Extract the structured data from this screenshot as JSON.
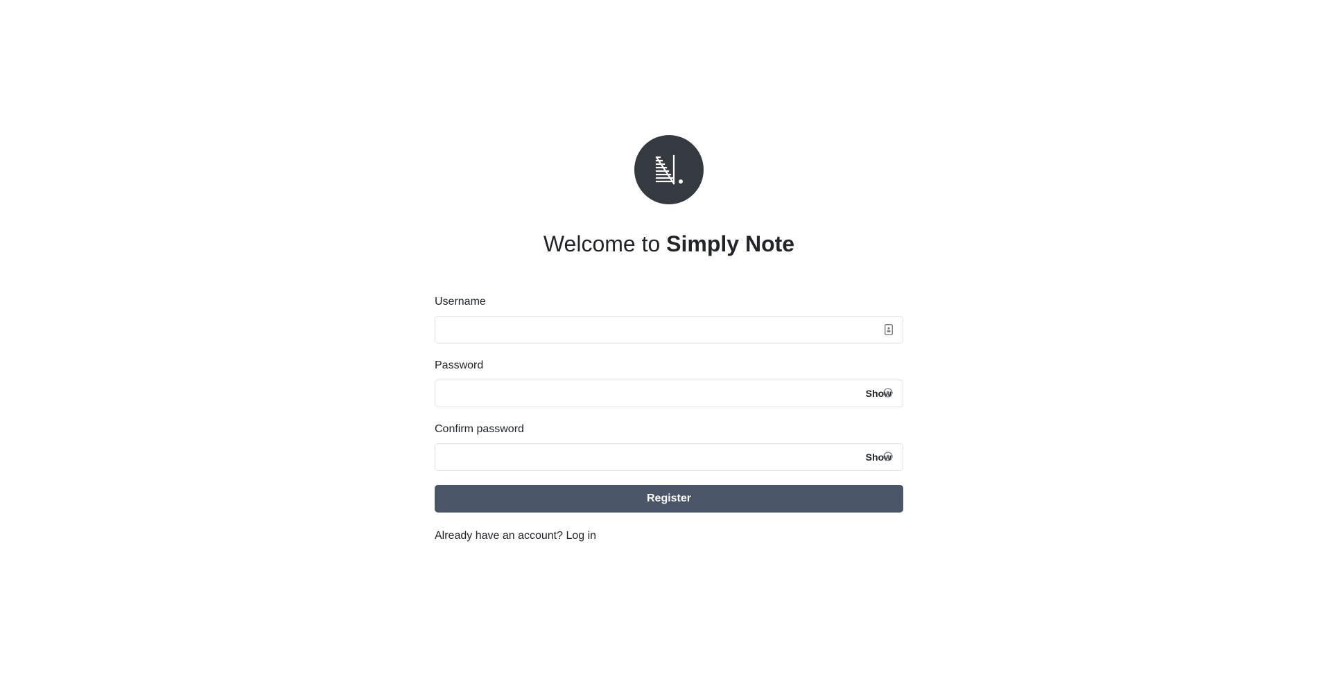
{
  "app": {
    "logo_icon": "simply-note-logo",
    "logo_bg_color": "#343a40"
  },
  "heading": {
    "prefix": "Welcome to",
    "brand": "Simply Note"
  },
  "form": {
    "username": {
      "label": "Username",
      "value": "",
      "placeholder": "",
      "icon": "contact-card-icon"
    },
    "password": {
      "label": "Password",
      "value": "",
      "placeholder": "",
      "toggle_label": "Show",
      "icon": "eye-icon"
    },
    "confirm_password": {
      "label": "Confirm password",
      "value": "",
      "placeholder": "",
      "toggle_label": "Show",
      "icon": "eye-icon"
    },
    "submit_label": "Register",
    "submit_color": "#4a5568"
  },
  "footer": {
    "prompt": "Already have an account?",
    "link_label": "Log in"
  }
}
